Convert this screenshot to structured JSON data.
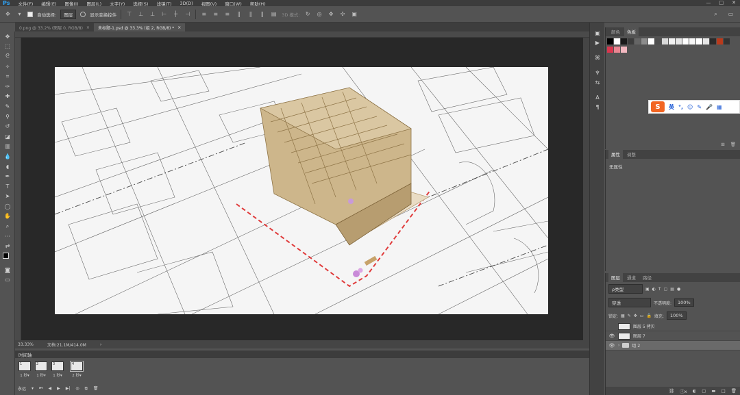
{
  "app": {
    "logo": "Ps"
  },
  "menu": [
    "文件(F)",
    "编辑(E)",
    "图像(I)",
    "图层(L)",
    "文字(Y)",
    "选择(S)",
    "滤镜(T)",
    "3D(D)",
    "视图(V)",
    "窗口(W)",
    "帮助(H)"
  ],
  "window_controls": [
    "—",
    "□",
    "✕"
  ],
  "options": {
    "auto_select_label": "自动选择:",
    "auto_select_value": "图层",
    "show_transform_label": "显示变换控件",
    "mode_3d_label": "3D 模式:"
  },
  "doc_tabs": [
    {
      "title": "0.png @ 33.2% (图层 0, RGB/8)",
      "close": "×"
    },
    {
      "title": "未标题-1.psd @ 33.3% (组 2, RGB/8) *",
      "close": "×"
    }
  ],
  "status": {
    "zoom": "33.33%",
    "doc": "文档:21.1M/414.0M",
    "arrow": "›"
  },
  "timeline": {
    "title": "时间轴",
    "frames": [
      {
        "num": "1",
        "duration": "1 秒▾"
      },
      {
        "num": "2",
        "duration": "1 秒▾"
      },
      {
        "num": "3",
        "duration": "1 秒▾"
      },
      {
        "num": "4",
        "duration": "2 秒▾"
      }
    ],
    "loop": "永远",
    "controls": [
      "▾",
      "⏮",
      "◀",
      "▶",
      "▶|"
    ]
  },
  "color_panel": {
    "tabs": [
      "颜色",
      "色板"
    ],
    "swatches_row1": [
      "#000000",
      "#ffffff",
      "#1a1a1a",
      "#3d3d3d",
      "#656565",
      "#8c8c8c",
      "#ffffff",
      "#4f4f4f",
      "#d9d9d9",
      "#f2f2f2",
      "#e6e6e6",
      "#ffffff",
      "#f7f7f7",
      "#ffffff",
      "#e6e6e6",
      "#2b2b2b",
      "#b93a1c",
      "#333333"
    ],
    "swatches_row2": [
      "#d9364e",
      "#e88591",
      "#f3b8c0"
    ]
  },
  "properties_panel": {
    "tabs": [
      "属性",
      "调整"
    ],
    "content": "无属性"
  },
  "layers_panel": {
    "tabs": [
      "图层",
      "通道",
      "路径"
    ],
    "filter_label": "ρ类型",
    "blend_mode": "穿透",
    "opacity_label": "不透明度:",
    "opacity_value": "100%",
    "lock_label": "锁定:",
    "fill_label": "填充:",
    "fill_value": "100%",
    "layers": [
      {
        "name": "图层 5 拷贝",
        "visible": false,
        "kind": "image"
      },
      {
        "name": "图层 7",
        "visible": true,
        "kind": "image"
      },
      {
        "name": "组 2",
        "visible": true,
        "kind": "group"
      }
    ],
    "footer": [
      "ⓕx",
      "◐",
      "▢",
      "□",
      "🗑"
    ]
  },
  "ime_bar": {
    "logo": "S",
    "lang": "英",
    "items": [
      "°,",
      "☺",
      "✎",
      "🎤",
      "▦"
    ]
  }
}
